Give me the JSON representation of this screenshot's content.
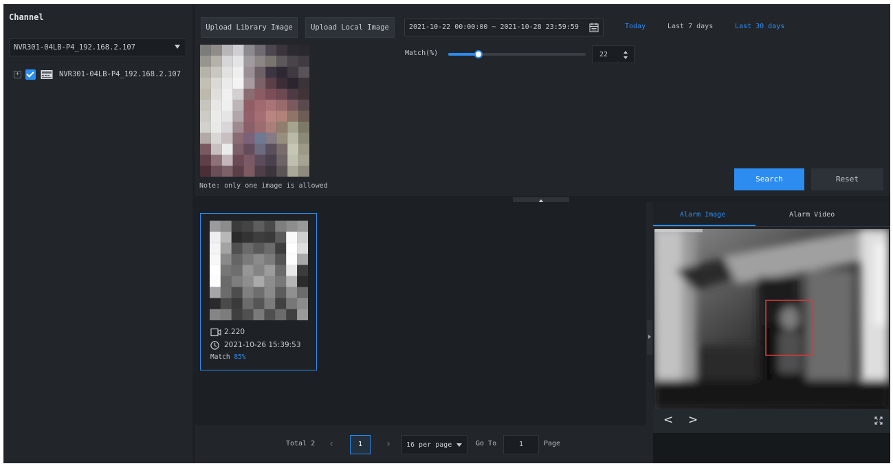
{
  "left_panel": {
    "title": "Channel",
    "device_select": "NVR301-04LB-P4_192.168.2.107",
    "tree_items": [
      {
        "label": "NVR301-04LB-P4_192.168.2.107",
        "checked": true
      }
    ]
  },
  "search": {
    "upload_library": "Upload Library Image",
    "upload_local": "Upload Local Image",
    "date_range": "2021-10-22 00:00:00 ~ 2021-10-28 23:59:59",
    "quick_ranges": [
      "Today",
      "Last 7 days",
      "Last 30 days"
    ],
    "match_label": "Match(%)",
    "match_value": "22",
    "note": "Note: only one image is allowed",
    "search_btn": "Search",
    "reset_btn": "Reset"
  },
  "results": {
    "cards": [
      {
        "channel": "2.220",
        "time": "2021-10-26 15:39:53",
        "match_label": "Match",
        "match_pct": "85%"
      }
    ]
  },
  "pagination": {
    "total": "Total 2",
    "current_page": "1",
    "per_page": "16 per page",
    "goto_label": "Go To",
    "goto_value": "1",
    "page_label": "Page"
  },
  "alarm": {
    "tab_image": "Alarm Image",
    "tab_video": "Alarm Video",
    "prev": "<",
    "next": ">"
  },
  "colors": {
    "accent": "#2c8cf0",
    "background": "#1c2024",
    "panel": "#22262b"
  },
  "icons": [
    "plus-icon",
    "checkbox-icon",
    "nvr-device-icon",
    "calendar-icon",
    "camera-icon",
    "clock-icon",
    "fullscreen-icon",
    "chevron-up-icon",
    "chevron-right-icon"
  ]
}
